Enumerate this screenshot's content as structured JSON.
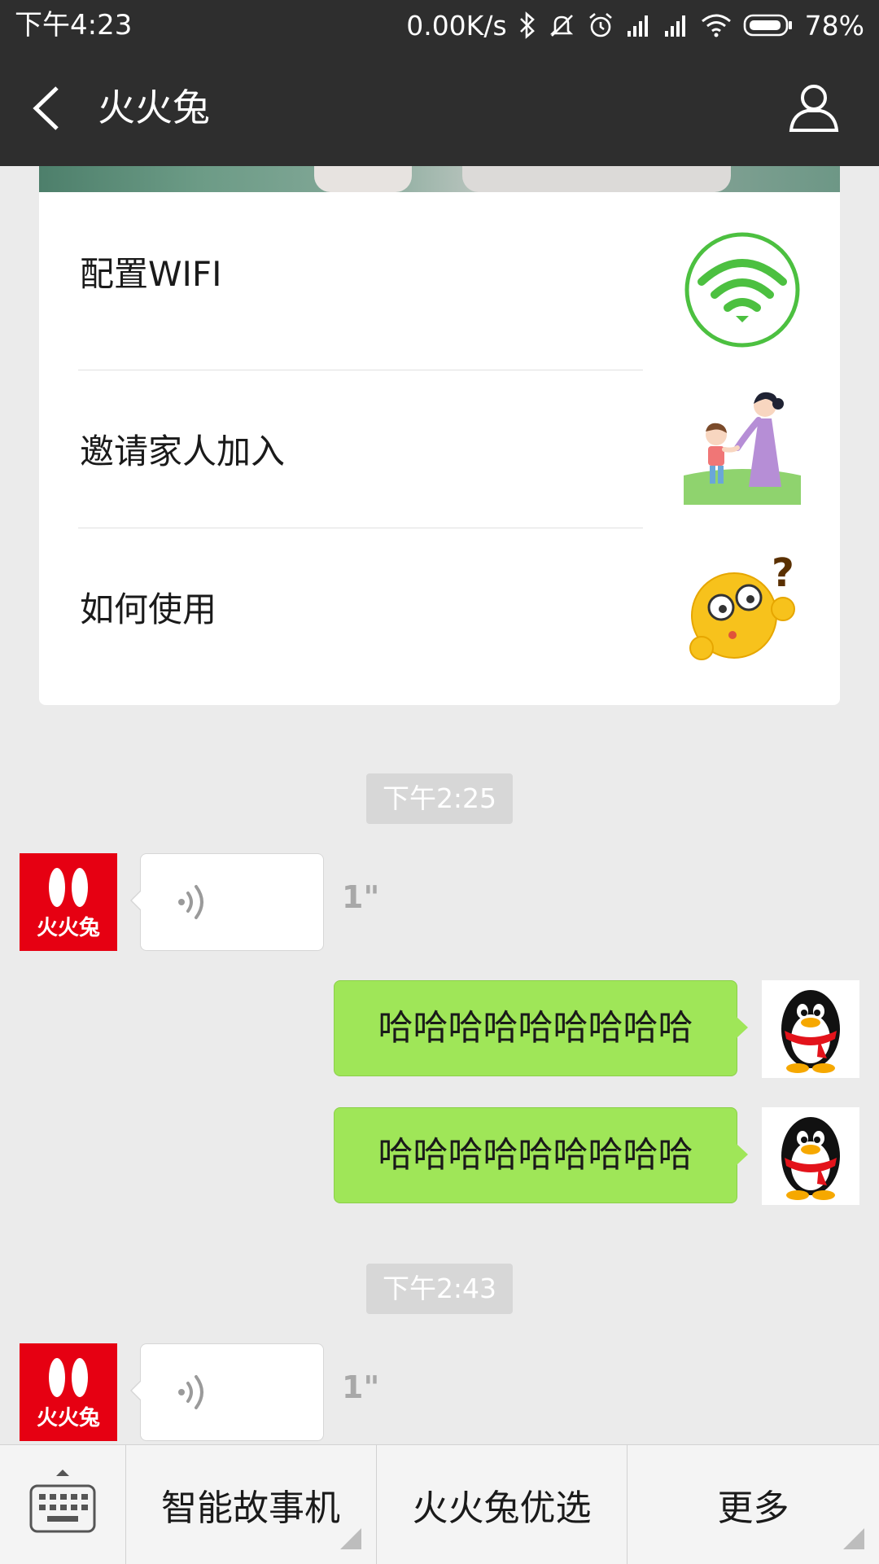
{
  "status_bar": {
    "time": "下午4:23",
    "net_speed": "0.00K/s",
    "battery": "78%",
    "icons": [
      "bluetooth-icon",
      "mute-icon",
      "alarm-icon",
      "signal-icon",
      "signal-icon",
      "wifi-icon",
      "battery-icon"
    ]
  },
  "header": {
    "title": "火火兔",
    "back_icon": "chevron-left-icon",
    "profile_icon": "person-icon"
  },
  "menu_card": {
    "items": [
      {
        "label": "配置WIFI",
        "icon": "wifi-circle-icon"
      },
      {
        "label": "邀请家人加入",
        "icon": "family-illustration"
      },
      {
        "label": "如何使用",
        "icon": "confused-face-icon"
      }
    ]
  },
  "chat": {
    "time_1": "下午2:25",
    "voice_1_duration": "1\"",
    "text_1": "哈哈哈哈哈哈哈哈哈",
    "text_2": "哈哈哈哈哈哈哈哈哈",
    "time_2": "下午2:43",
    "voice_2_duration": "1\"",
    "brand_avatar_text": "火火兔"
  },
  "bottom_menu": {
    "keyboard_icon": "keyboard-icon",
    "items": [
      {
        "label": "智能故事机"
      },
      {
        "label": "火火兔优选"
      },
      {
        "label": "更多"
      }
    ]
  },
  "colors": {
    "nav_bg": "#2e2e2e",
    "chat_bg": "#ebebeb",
    "bubble_green": "#9fe658",
    "brand_red": "#e60012",
    "wifi_green": "#4cc040"
  }
}
